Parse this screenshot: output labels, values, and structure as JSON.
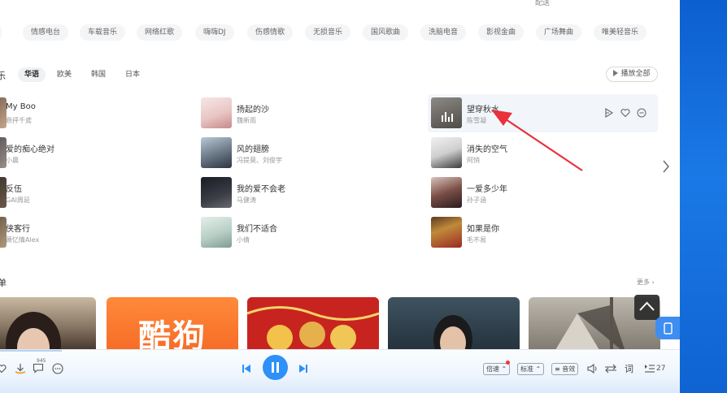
{
  "top_cut_text": "配送",
  "genre_tags": [
    "",
    "情感电台",
    "车载音乐",
    "网络红歌",
    "嗨嗨DJ",
    "伤感情歌",
    "无损音乐",
    "国风歌曲",
    "洗脑电音",
    "影视金曲",
    "广场舞曲",
    "唯美轻音乐"
  ],
  "section1": {
    "title_cut": "乐",
    "tabs": [
      "华语",
      "欧美",
      "韩国",
      "日本"
    ],
    "active_tab": "华语",
    "play_all": "播放全部"
  },
  "songs": [
    {
      "title": "My Boo",
      "artist": "悬抨千鳶"
    },
    {
      "title": "扬起的沙",
      "artist": "魏新雨"
    },
    {
      "title": "望穿秋水",
      "artist": "陈雪凝"
    },
    {
      "title": "爱的痴心绝对",
      "artist": "小晨"
    },
    {
      "title": "风的翅膀",
      "artist": "冯提莫、刘俊宇"
    },
    {
      "title": "消失的空气",
      "artist": "阿悄"
    },
    {
      "title": "反伍",
      "artist": "GAI周延"
    },
    {
      "title": "我的爱不会老",
      "artist": "马健涛"
    },
    {
      "title": "一爱多少年",
      "artist": "孙子涵"
    },
    {
      "title": "侠客行",
      "artist": "萧忆情Alex"
    },
    {
      "title": "我们不适合",
      "artist": "小倩"
    },
    {
      "title": "如果是你",
      "artist": "毛不易"
    }
  ],
  "section2": {
    "title_cut": "单",
    "more": "更多 ›",
    "kugou_card_text": "酷狗"
  },
  "player": {
    "comment_count": "945",
    "speed_label": "倍速",
    "quality_label": "标准",
    "effect_label": "音效",
    "lyrics_label": "词",
    "queue_count": "27"
  },
  "colors": {
    "accent": "#2e90f8",
    "annotation_arrow": "#e8323c",
    "desktop_blue": "#1a79e6"
  }
}
